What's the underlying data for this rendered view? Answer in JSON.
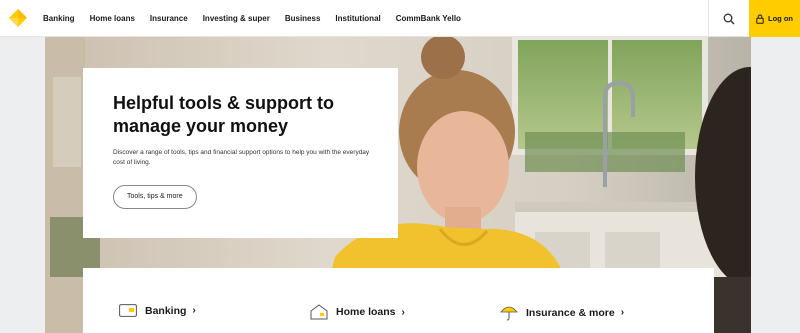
{
  "header": {
    "logo_icon": "commbank-diamond-logo",
    "nav": [
      {
        "label": "Banking"
      },
      {
        "label": "Home loans"
      },
      {
        "label": "Insurance"
      },
      {
        "label": "Investing & super"
      },
      {
        "label": "Business"
      },
      {
        "label": "Institutional"
      },
      {
        "label": "CommBank Yello"
      }
    ],
    "search_icon": "search-icon",
    "logon_label": "Log on",
    "logon_icon": "lock-icon"
  },
  "hero": {
    "title": "Helpful tools & support to manage your money",
    "description": "Discover a range of tools, tips and financial support options to help you with the everyday cost of living.",
    "cta_label": "Tools, tips & more",
    "accent_color": "#ffcc00"
  },
  "quick_links": [
    {
      "label": "Banking",
      "icon": "card-icon"
    },
    {
      "label": "Home loans",
      "icon": "house-icon"
    },
    {
      "label": "Insurance & more",
      "icon": "umbrella-icon"
    }
  ],
  "colors": {
    "brand_yellow": "#ffcc00",
    "text": "#1a1a1a",
    "background": "#eceef0"
  }
}
